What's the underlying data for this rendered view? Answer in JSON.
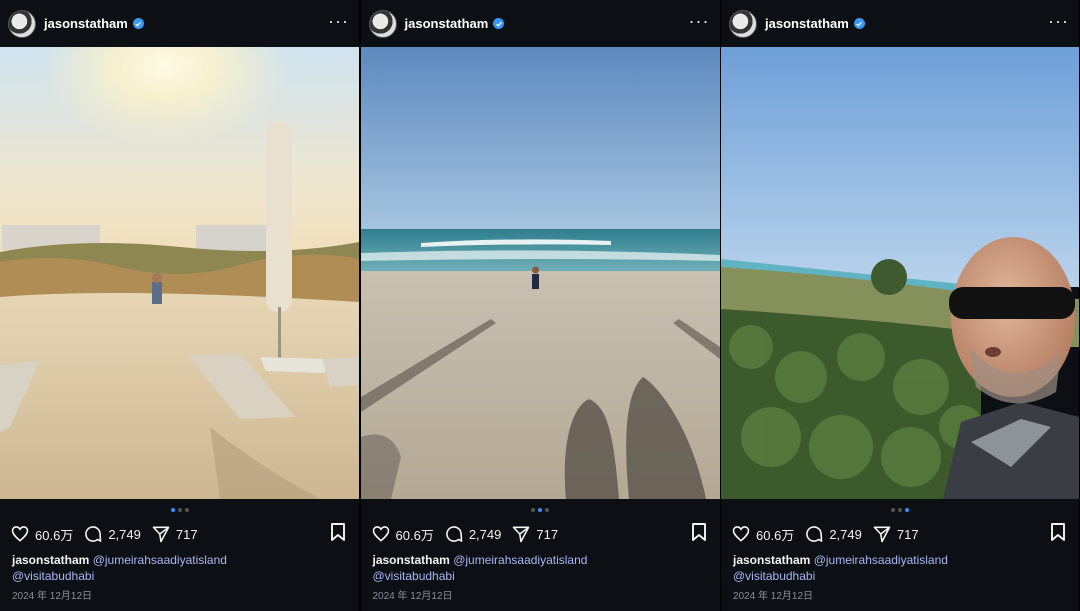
{
  "posts": [
    {
      "username": "jasonstatham",
      "likes": "60.6万",
      "comments": "2,749",
      "shares": "717",
      "mention1": "@jumeirahsaadiyatisland",
      "mention2": "@visitabudhabi",
      "date": "2024 年 12月12日",
      "active_slide": 1
    },
    {
      "username": "jasonstatham",
      "likes": "60.6万",
      "comments": "2,749",
      "shares": "717",
      "mention1": "@jumeirahsaadiyatisland",
      "mention2": "@visitabudhabi",
      "date": "2024 年 12月12日",
      "active_slide": 2
    },
    {
      "username": "jasonstatham",
      "likes": "60.6万",
      "comments": "2,749",
      "shares": "717",
      "mention1": "@jumeirahsaadiyatisland",
      "mention2": "@visitabudhabi",
      "date": "2024 年 12月12日",
      "active_slide": 3
    }
  ],
  "icons": [
    "verified-badge-icon",
    "more-options-icon",
    "heart-icon",
    "comment-icon",
    "share-icon",
    "bookmark-icon"
  ],
  "colors": {
    "background": "#0c0f14",
    "link": "#a9b6f5",
    "verified": "#3897f0",
    "active_dot": "#3e8ef7"
  }
}
